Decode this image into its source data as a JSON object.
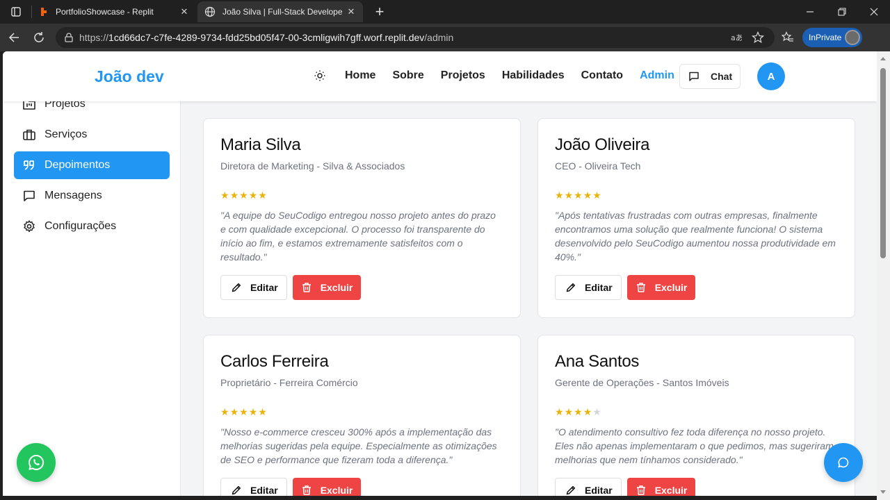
{
  "browser": {
    "tabs": [
      {
        "title": "PortfolioShowcase - Replit",
        "close": "✕"
      },
      {
        "title": "João Silva | Full-Stack Developer P",
        "close": "✕"
      }
    ],
    "new_tab": "+",
    "url_prefix": "https://",
    "url_host": "1cd66dc7-c7fe-4289-9734-fdd25bd05f47-00-3cmligwih7gff.worf.replit.dev",
    "url_path": "/admin",
    "inprivate_label": "InPrivate",
    "accent_color": "#1a5fb4"
  },
  "site": {
    "brand": "João dev",
    "nav": [
      "Home",
      "Sobre",
      "Projetos",
      "Habilidades",
      "Contato",
      "Admin"
    ],
    "active_nav": "Admin",
    "chat_label": "Chat",
    "avatar_initial": "A",
    "accent_color": "#2196f3"
  },
  "sidebar": {
    "items": [
      {
        "label": "Projetos",
        "icon": "folder-kanban-icon"
      },
      {
        "label": "Serviços",
        "icon": "briefcase-icon"
      },
      {
        "label": "Depoimentos",
        "icon": "quote-icon",
        "active": true
      },
      {
        "label": "Mensagens",
        "icon": "message-square-icon"
      },
      {
        "label": "Configurações",
        "icon": "settings-gear-icon"
      }
    ]
  },
  "testimonials": [
    {
      "name": "Maria Silva",
      "role": "Diretora de Marketing - Silva & Associados",
      "rating": 5,
      "quote": "\"A equipe do SeuCodigo entregou nosso projeto antes do prazo e com qualidade excepcional. O processo foi transparente do início ao fim, e estamos extremamente satisfeitos com o resultado.\""
    },
    {
      "name": "João Oliveira",
      "role": "CEO - Oliveira Tech",
      "rating": 5,
      "quote": "\"Após tentativas frustradas com outras empresas, finalmente encontramos uma solução que realmente funciona! O sistema desenvolvido pelo SeuCodigo aumentou nossa produtividade em 40%.\""
    },
    {
      "name": "Carlos Ferreira",
      "role": "Proprietário - Ferreira Comércio",
      "rating": 5,
      "quote": "\"Nosso e-commerce cresceu 300% após a implementação das melhorias sugeridas pela equipe. Especialmente as otimizações de SEO e performance que fizeram toda a diferença.\""
    },
    {
      "name": "Ana Santos",
      "role": "Gerente de Operações - Santos Imóveis",
      "rating": 4,
      "quote": "\"O atendimento consultivo fez toda diferença no nosso projeto. Eles não apenas implementaram o que pedimos, mas sugeriram melhorias que nem tínhamos considerado.\""
    }
  ],
  "actions": {
    "edit_label": "Editar",
    "delete_label": "Excluir",
    "delete_color": "#ef4444"
  },
  "star_color": "#eab308"
}
